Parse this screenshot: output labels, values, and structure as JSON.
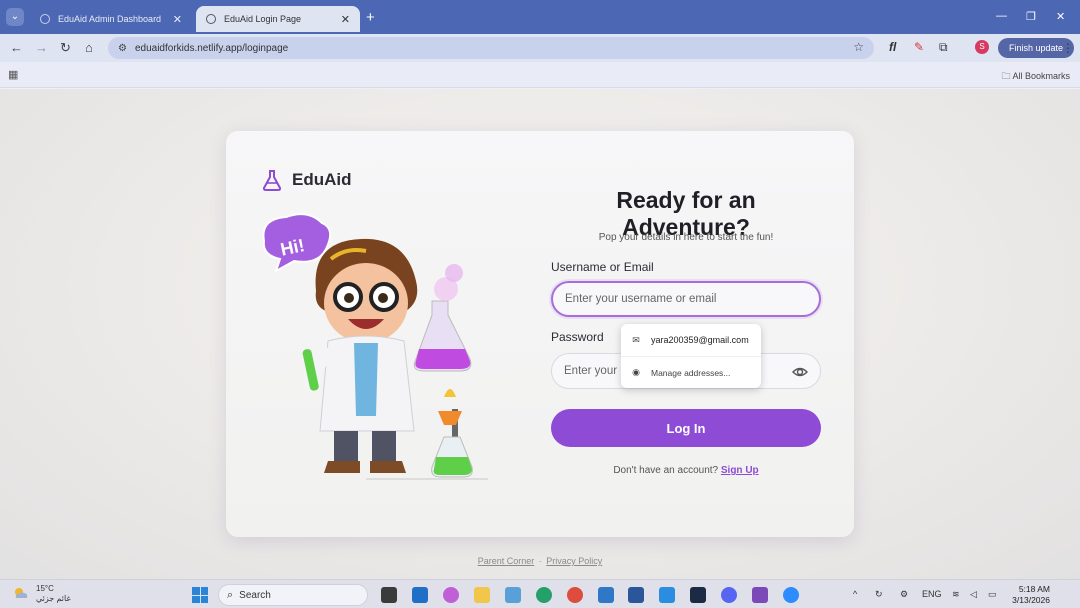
{
  "browser": {
    "tabs": [
      {
        "title": "EduAid Admin Dashboard",
        "active": false
      },
      {
        "title": "EduAid Login Page",
        "active": true
      }
    ],
    "url": "eduaidforkids.netlify.app/loginpage",
    "finish_update": "Finish update",
    "all_bookmarks": "All Bookmarks",
    "profile_initial": "S"
  },
  "page": {
    "brand": "EduAid",
    "badge_text": "Hi!",
    "title": "Ready for an Adventure?",
    "subtitle": "Pop your details in here to start the fun!",
    "username_label": "Username or Email",
    "username_placeholder": "Enter your username or email",
    "password_label": "Password",
    "password_placeholder": "Enter your p",
    "login_button": "Log In",
    "signup_prompt": "Don't have an account?",
    "signup_link": "Sign Up",
    "footer_links": [
      "Parent Corner",
      "Privacy Policy"
    ],
    "accent_color": "#8d4bd6"
  },
  "autofill": {
    "email": "yara200359@gmail.com",
    "manage": "Manage addresses..."
  },
  "taskbar": {
    "temperature": "15°C",
    "weather_desc": "غائم جزئي",
    "search": "Search",
    "language": "ENG",
    "time": "5:18 AM",
    "date": "3/13/2026"
  }
}
